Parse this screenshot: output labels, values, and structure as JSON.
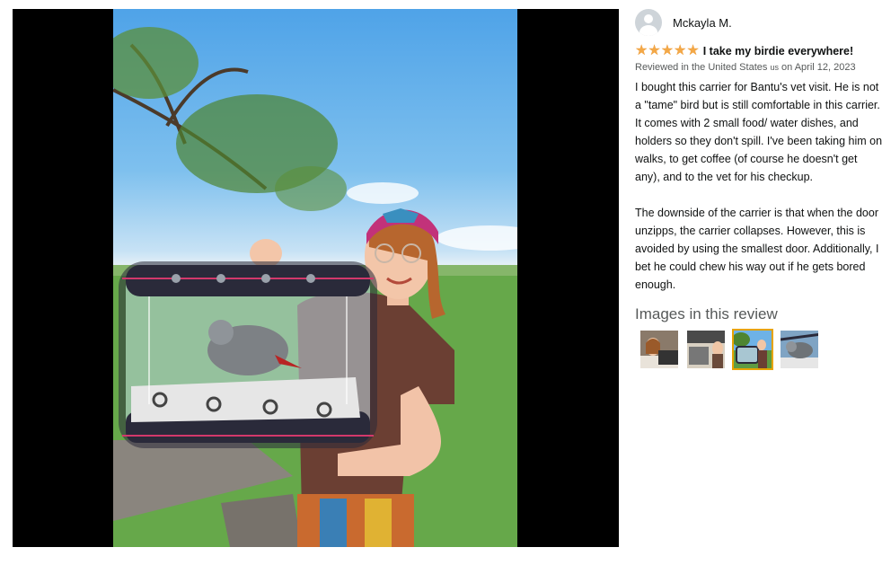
{
  "viewer": {
    "photo_alt": "Woman holding a clear bird carrier with a grey parrot inside, standing in a park"
  },
  "review": {
    "reviewer_name": "Mckayla M.",
    "rating": 5,
    "stars": [
      "★",
      "★",
      "★",
      "★",
      "★"
    ],
    "title": "I take my birdie everywhere!",
    "meta_prefix": "Reviewed in the United States",
    "meta_flag": "us",
    "meta_suffix": "on April 12, 2023",
    "paragraphs": [
      "I bought this carrier for Bantu's vet visit. He is not a \"tame\" bird but is still comfortable in this carrier. It comes with 2 small food/ water dishes, and holders so they don't spill. I've been taking him on walks, to get coffee (of course he doesn't get any), and to the vet for his checkup.",
      "The downside of the carrier is that when the door unzipps, the carrier collapses. However, this is avoided by using the smallest door. Additionally, I bet he could chew his way out if he gets bored enough."
    ],
    "images_heading": "Images in this review",
    "thumbnails": [
      {
        "name": "thumbnail-1",
        "selected": false
      },
      {
        "name": "thumbnail-2",
        "selected": false
      },
      {
        "name": "thumbnail-3",
        "selected": true
      },
      {
        "name": "thumbnail-4",
        "selected": false
      }
    ],
    "colors": {
      "star": "#f3a847",
      "selected_border": "#e7a300",
      "meta": "#565959"
    }
  }
}
